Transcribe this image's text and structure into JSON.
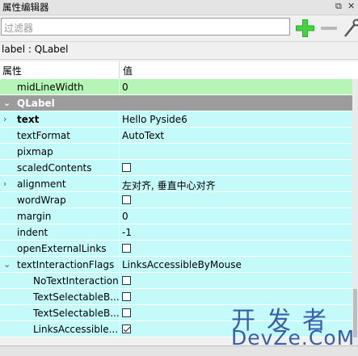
{
  "window": {
    "title": "属性编辑器",
    "float_icon": "restore-icon",
    "close_icon": "close-icon"
  },
  "toolbar": {
    "filter_placeholder": "过滤器"
  },
  "object_line": "label : QLabel",
  "header": {
    "col1": "属性",
    "col2": "值"
  },
  "rows": [
    {
      "name": "midLineWidth",
      "value": "0",
      "style": "green"
    },
    {
      "name": "QLabel",
      "value": "",
      "style": "section",
      "expander": "chevron-down-icon"
    },
    {
      "name": "text",
      "value": "Hello Pyside6",
      "style": "cyan",
      "bold": true,
      "expander": "chevron-right-icon"
    },
    {
      "name": "textFormat",
      "value": "AutoText",
      "style": "cyan"
    },
    {
      "name": "pixmap",
      "value": "",
      "style": "cyan"
    },
    {
      "name": "scaledContents",
      "value": "",
      "style": "cyan",
      "checkbox": false
    },
    {
      "name": "alignment",
      "value": "左对齐, 垂直中心对齐",
      "style": "cyan",
      "expander": "chevron-right-icon"
    },
    {
      "name": "wordWrap",
      "value": "",
      "style": "cyan",
      "checkbox": false
    },
    {
      "name": "margin",
      "value": "0",
      "style": "cyan"
    },
    {
      "name": "indent",
      "value": "-1",
      "style": "cyan"
    },
    {
      "name": "openExternalLinks",
      "value": "",
      "style": "cyan",
      "checkbox": false
    },
    {
      "name": "textInteractionFlags",
      "value": "LinksAccessibleByMouse",
      "style": "cyan",
      "expander": "chevron-down-icon"
    },
    {
      "name": "NoTextInteraction",
      "value": "",
      "style": "cyan",
      "checkbox": false,
      "indent": true
    },
    {
      "name": "TextSelectableB...",
      "value": "",
      "style": "cyan",
      "checkbox": false,
      "indent": true
    },
    {
      "name": "TextSelectableB...",
      "value": "",
      "style": "cyan",
      "checkbox": false,
      "indent": true
    },
    {
      "name": "LinksAccessible...",
      "value": "",
      "style": "cyan",
      "checkbox": true,
      "indent": true
    }
  ],
  "watermark": {
    "line1": "开发者",
    "line2": "DevZe.CoM"
  }
}
